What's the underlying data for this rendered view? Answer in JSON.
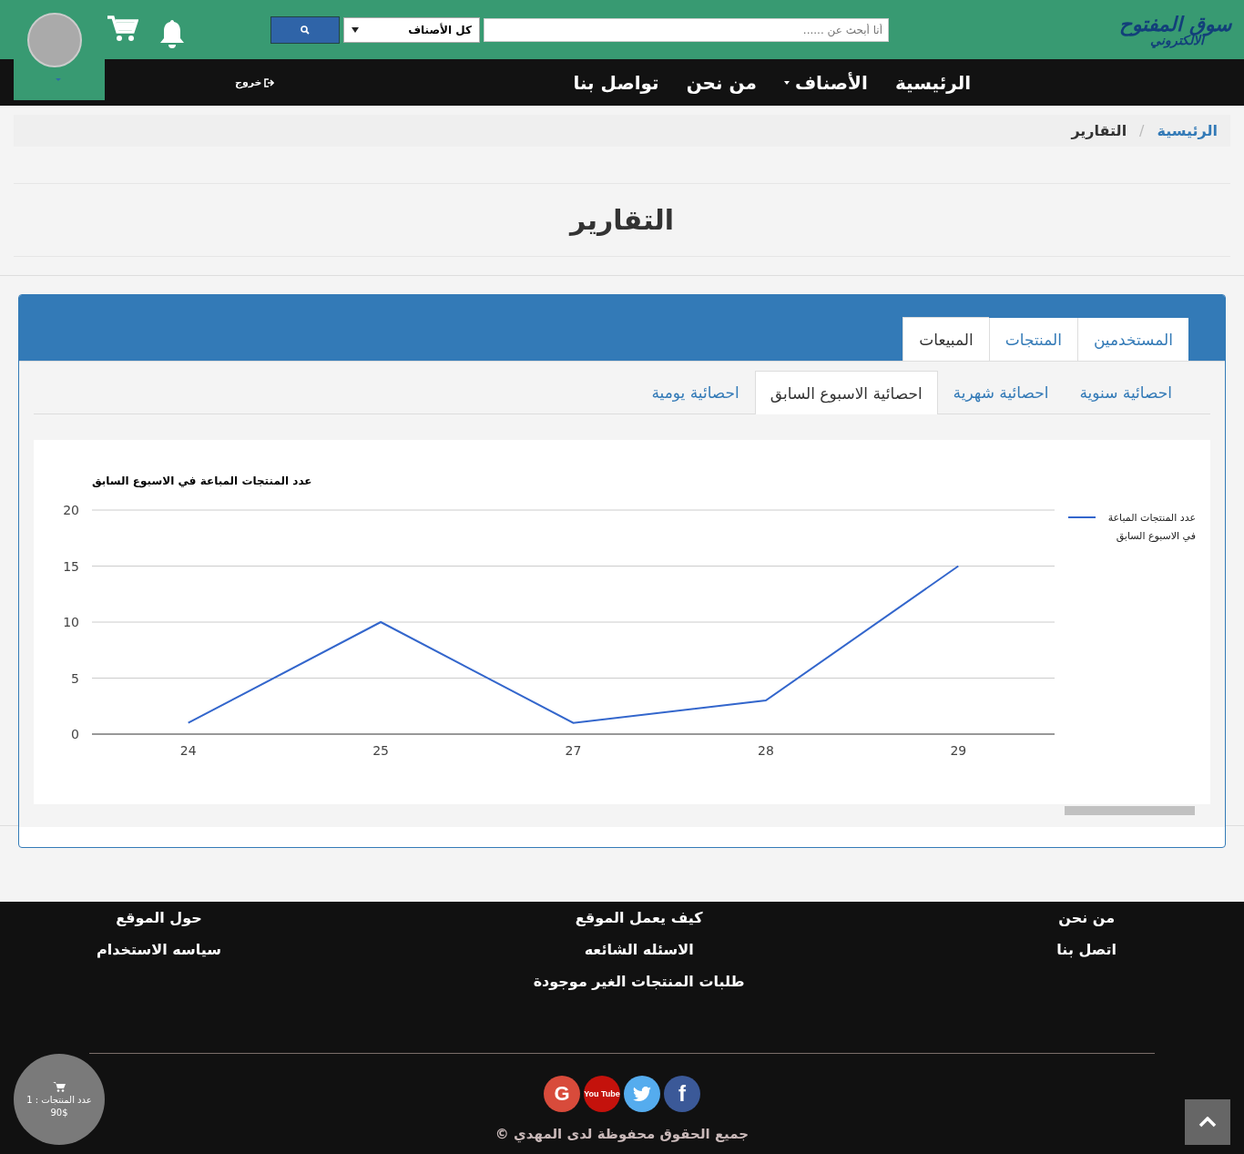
{
  "header": {
    "logo": {
      "line_1": "سوق المفتوح",
      "line_2": "الالكتروني"
    },
    "search": {
      "placeholder": "أنا أبحث عن ......"
    },
    "category_select": {
      "value": "كل الأصناف"
    }
  },
  "navbar": {
    "items": [
      {
        "label": "الرئيسية",
        "dropdown": false
      },
      {
        "label": "الأصناف",
        "dropdown": true
      },
      {
        "label": "من نحن",
        "dropdown": false
      },
      {
        "label": "تواصل بنا",
        "dropdown": false
      }
    ],
    "logout": "خروج"
  },
  "breadcrumb_separator": "/",
  "breadcrumb": [
    {
      "label": "الرئيسية",
      "selected": false
    },
    {
      "label": "التقارير",
      "selected": true
    }
  ],
  "page_title": "التقارير",
  "tabs": [
    {
      "label": "المستخدمين",
      "selected": false
    },
    {
      "label": "المنتجات",
      "selected": false
    },
    {
      "label": "المبيعات",
      "selected": true
    }
  ],
  "subtabs": [
    {
      "label": "احصائية سنوية",
      "selected": false
    },
    {
      "label": "احصائية شهرية",
      "selected": false
    },
    {
      "label": "احصائية الاسبوع السابق",
      "selected": true
    },
    {
      "label": "احصائية يومية",
      "selected": false
    }
  ],
  "chart_data": {
    "type": "line",
    "title": "عدد المنتجات المباعة في الاسبوع السابق",
    "categories": [
      "24",
      "25",
      "27",
      "28",
      "29"
    ],
    "series": [
      {
        "name": "عدد المنتجات المباعة في الاسبوع السابق",
        "color": "#3366cc",
        "values": [
          1,
          10,
          1,
          3,
          15
        ]
      }
    ],
    "ylim": [
      0,
      20
    ],
    "grid": true,
    "yticks": [
      0,
      5,
      10,
      15,
      20
    ]
  },
  "footer": {
    "columns": [
      [
        "من نحن",
        "اتصل بنا"
      ],
      [
        "كيف يعمل الموقع",
        "الاسئله الشائعه",
        "طلبات المنتجات الغير موجودة"
      ],
      [
        "حول الموقع",
        "سياسه الاستخدام"
      ]
    ],
    "social": [
      {
        "kind": "facebook",
        "label": "f",
        "color": "#3b5998"
      },
      {
        "kind": "twitter",
        "color": "#55acee"
      },
      {
        "kind": "youtube",
        "label": "You Tube",
        "color": "#c4120c"
      },
      {
        "kind": "google",
        "label": "G",
        "color": "#d84b3b"
      }
    ],
    "copyright": "جميع الحقوق محفوظة لدى المهدي ©"
  },
  "cart_bubble": {
    "count_label": "عدد المنتجات : 1",
    "total": "90$"
  }
}
